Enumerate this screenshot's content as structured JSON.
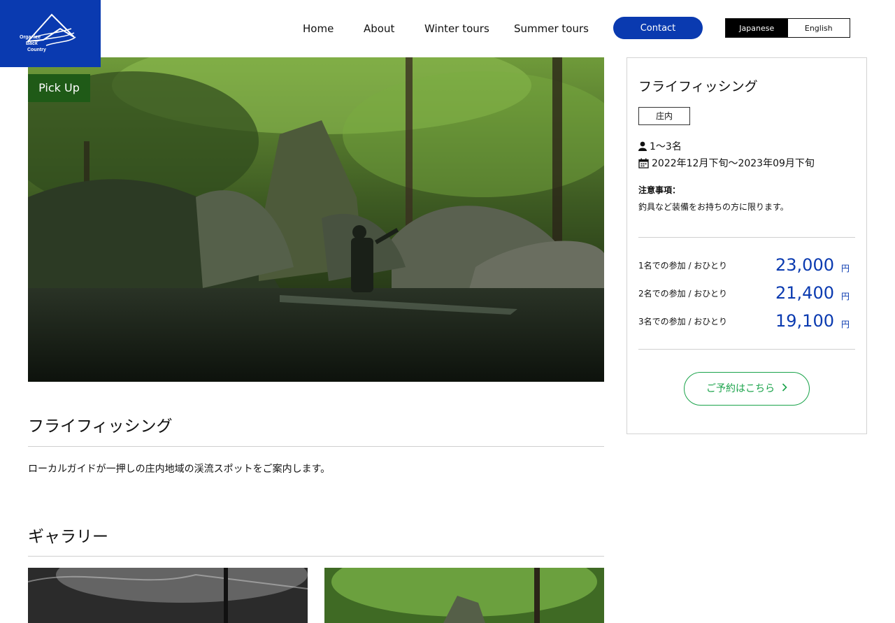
{
  "header": {
    "logo_lines": [
      "Organize",
      "Back",
      "Country"
    ],
    "nav": [
      {
        "label": "Home"
      },
      {
        "label": "About"
      },
      {
        "label": "Winter tours"
      },
      {
        "label": "Summer tours"
      }
    ],
    "contact_label": "Contact",
    "languages": [
      {
        "label": "Japanese",
        "active": true
      },
      {
        "label": "English",
        "active": false
      }
    ]
  },
  "hero": {
    "badge": "Pick Up"
  },
  "main": {
    "title": "フライフィッシング",
    "description": "ローカルガイドが一押しの庄内地域の渓流スポットをご案内します。",
    "gallery_title": "ギャラリー"
  },
  "card": {
    "title": "フライフィッシング",
    "region": "庄内",
    "participants": "1〜3名",
    "period": "2022年12月下旬〜2023年09月下旬",
    "note_label": "注意事項：",
    "note_text": "釣具など装備をお持ちの方に限ります。",
    "prices": [
      {
        "label": "1名での参加 / おひとり",
        "value": "23,000",
        "unit": "円"
      },
      {
        "label": "2名での参加 / おひとり",
        "value": "21,400",
        "unit": "円"
      },
      {
        "label": "3名での参加 / おひとり",
        "value": "19,100",
        "unit": "円"
      }
    ],
    "reserve_label": "ご予約はこちら"
  },
  "colors": {
    "brand_blue": "#0a3ab0",
    "pickup_green": "#1f5a17",
    "reserve_green": "#1aa34a"
  },
  "icons": {
    "person": "person-icon",
    "calendar": "calendar-icon",
    "chevron": "chevron-right-icon"
  }
}
